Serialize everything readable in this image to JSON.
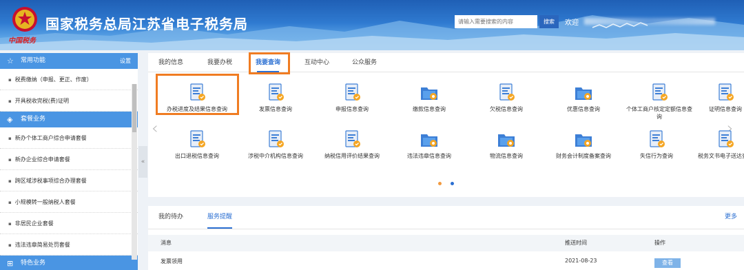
{
  "header": {
    "logo_text": "中国税务",
    "title": "国家税务总局江苏省电子税务局",
    "search_placeholder": "请输入需要搜索的内容",
    "search_button": "搜索",
    "welcome": "欢迎"
  },
  "sidebar": {
    "common": {
      "title": "常用功能",
      "settings": "设置",
      "icon": "star-icon"
    },
    "common_items": [
      "税费缴纳（申报、更正、作废）",
      "开具税收完税(费)证明"
    ],
    "packages": {
      "title": "套餐业务",
      "icon": "package-icon"
    },
    "package_items": [
      "新办个体工商户综合申请套餐",
      "新办企业综合申请套餐",
      "跨区域涉税事项综合办理套餐",
      "小规模转一般纳税人套餐",
      "非居民企业套餐",
      "违法违章简易处罚套餐"
    ],
    "special": {
      "title": "特色业务",
      "icon": "grid-icon"
    },
    "collapse_label": "«"
  },
  "main_tabs": [
    "我的信息",
    "我要办税",
    "我要查询",
    "互动中心",
    "公众服务"
  ],
  "query_items": [
    {
      "label": "办税进度及结果信息查询",
      "icon": "document-progress-icon"
    },
    {
      "label": "发票信息查询",
      "icon": "invoice-search-icon"
    },
    {
      "label": "申报信息查询",
      "icon": "declaration-chart-icon"
    },
    {
      "label": "缴款信息查询",
      "icon": "payment-chart-icon"
    },
    {
      "label": "欠税信息查询",
      "icon": "tax-owed-icon"
    },
    {
      "label": "优惠信息查询",
      "icon": "discount-folder-icon"
    },
    {
      "label": "个体工商户核定定额信息查询",
      "icon": "individual-business-icon"
    },
    {
      "label": "证明信息查询",
      "icon": "certificate-icon"
    },
    {
      "label": "出口退税信息查询",
      "icon": "export-refund-icon"
    },
    {
      "label": "涉税中介机构信息查询",
      "icon": "agency-building-icon"
    },
    {
      "label": "纳税信用评价结果查询",
      "icon": "credit-evaluation-icon"
    },
    {
      "label": "违法违章信息查询",
      "icon": "violation-folder-icon"
    },
    {
      "label": "物流信息查询",
      "icon": "logistics-folder-icon"
    },
    {
      "label": "财务会计制度备案查询",
      "icon": "accounting-filing-icon"
    },
    {
      "label": "失信行为查询",
      "icon": "dishonesty-icon"
    },
    {
      "label": "税务文书电子送达查询",
      "icon": "e-document-icon"
    }
  ],
  "carousel": {
    "prev": "‹",
    "next": "›",
    "pages": 2,
    "current": 2
  },
  "todo_panel": {
    "tabs": [
      "我的待办",
      "服务提醒"
    ],
    "more": "更多",
    "columns": [
      "消息",
      "推送时间",
      "操作"
    ],
    "rows": [
      {
        "message": "发票领用",
        "time": "2021-08-23",
        "action": "查看"
      }
    ]
  },
  "colors": {
    "primary": "#2b6fd2",
    "highlight": "#f07c22",
    "sidebar_header": "#4a95e3"
  }
}
